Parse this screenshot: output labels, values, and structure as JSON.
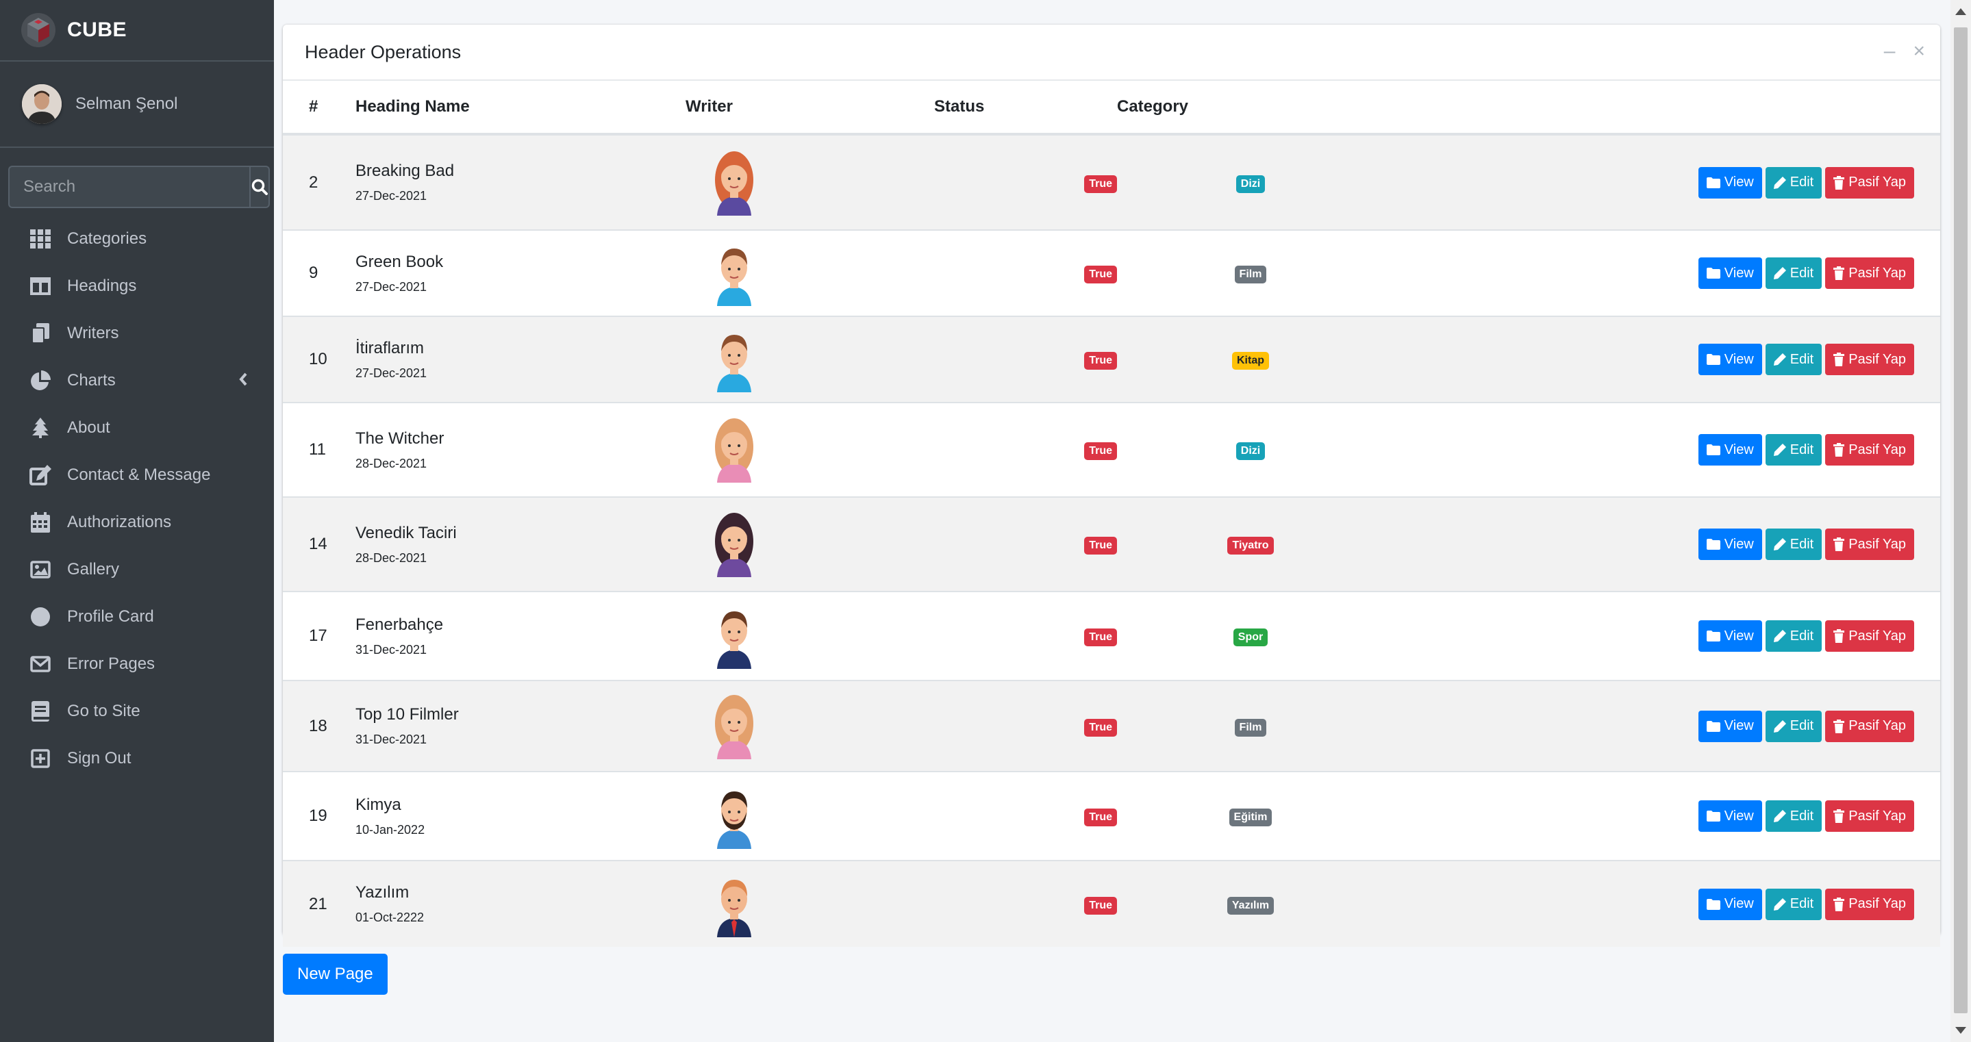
{
  "brand": {
    "name": "CUBE"
  },
  "user": {
    "name": "Selman Şenol"
  },
  "search": {
    "placeholder": "Search"
  },
  "nav": [
    {
      "label": "Categories",
      "icon": "grid-icon"
    },
    {
      "label": "Headings",
      "icon": "columns-icon"
    },
    {
      "label": "Writers",
      "icon": "copy-icon"
    },
    {
      "label": "Charts",
      "icon": "pie-chart-icon"
    },
    {
      "label": "About",
      "icon": "tree-icon"
    },
    {
      "label": "Contact & Message",
      "icon": "edit-icon"
    },
    {
      "label": "Authorizations",
      "icon": "calendar-icon"
    },
    {
      "label": "Gallery",
      "icon": "image-icon"
    },
    {
      "label": "Profile Card",
      "icon": "circle-icon"
    },
    {
      "label": "Error Pages",
      "icon": "envelope-icon"
    },
    {
      "label": "Go to Site",
      "icon": "book-icon"
    },
    {
      "label": "Sign Out",
      "icon": "plus-square-icon"
    }
  ],
  "card": {
    "title": "Header Operations"
  },
  "table": {
    "columns": [
      "#",
      "Heading Name",
      "Writer",
      "Status",
      "Category"
    ],
    "buttons": {
      "view": "View",
      "edit": "Edit",
      "delete": "Pasif Yap"
    },
    "rows": [
      {
        "id": "2",
        "name": "Breaking Bad",
        "date": "27-Dec-2021",
        "status": "True",
        "category": "Dizi",
        "category_color": "#17a2b8",
        "avatar": "woman-red-hair"
      },
      {
        "id": "9",
        "name": "Green Book",
        "date": "27-Dec-2021",
        "status": "True",
        "category": "Film",
        "category_color": "#6c757d",
        "avatar": "man-brown-hair"
      },
      {
        "id": "10",
        "name": "İtiraflarım",
        "date": "27-Dec-2021",
        "status": "True",
        "category": "Kitap",
        "category_color": "#ffc107",
        "avatar": "man-brown-hair"
      },
      {
        "id": "11",
        "name": "The Witcher",
        "date": "28-Dec-2021",
        "status": "True",
        "category": "Dizi",
        "category_color": "#17a2b8",
        "avatar": "woman-blonde"
      },
      {
        "id": "14",
        "name": "Venedik Taciri",
        "date": "28-Dec-2021",
        "status": "True",
        "category": "Tiyatro",
        "category_color": "#dc3545",
        "avatar": "woman-dark-hair"
      },
      {
        "id": "17",
        "name": "Fenerbahçe",
        "date": "31-Dec-2021",
        "status": "True",
        "category": "Spor",
        "category_color": "#28a745",
        "avatar": "man-suit"
      },
      {
        "id": "18",
        "name": "Top 10 Filmler",
        "date": "31-Dec-2021",
        "status": "True",
        "category": "Film",
        "category_color": "#6c757d",
        "avatar": "woman-blonde"
      },
      {
        "id": "19",
        "name": "Kimya",
        "date": "10-Jan-2022",
        "status": "True",
        "category": "Eğitim",
        "category_color": "#6c757d",
        "avatar": "man-beard"
      },
      {
        "id": "21",
        "name": "Yazılım",
        "date": "01-Oct-2222",
        "status": "True",
        "category": "Yazılım",
        "category_color": "#6c757d",
        "avatar": "man-ginger"
      }
    ]
  },
  "new_page_button": "New Page"
}
